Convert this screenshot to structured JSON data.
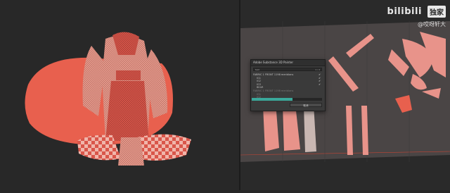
{
  "watermark": {
    "logo": "bilibili",
    "badge": "独家",
    "user": "@哎呀轩大"
  },
  "dialog": {
    "title": "Adobe Substance 3D Painter",
    "field_label": "test",
    "field_value": "1 / 2",
    "items": [
      {
        "label": "FABRIC 1 FRONT 1198 meridians",
        "indent": false,
        "dim": false,
        "checked": true
      },
      {
        "label": "IG1",
        "indent": true,
        "dim": false,
        "checked": true
      },
      {
        "label": "IG2",
        "indent": true,
        "dim": false,
        "checked": true
      },
      {
        "label": "IG3",
        "indent": true,
        "dim": false,
        "checked": true
      },
      {
        "label": "BEAR",
        "indent": true,
        "dim": false,
        "checked": false
      },
      {
        "label": "FABRIC 1 FRONT 1198 meridians",
        "indent": false,
        "dim": true,
        "checked": false
      },
      {
        "label": "IG1",
        "indent": true,
        "dim": true,
        "checked": false
      },
      {
        "label": "IG2",
        "indent": true,
        "dim": true,
        "checked": false
      }
    ],
    "progress_fraction": 0.58,
    "cancel_label": "取消"
  },
  "colors": {
    "mesh": "#e8604e",
    "mesh_light": "#f08a78",
    "progress": "#3aa89a",
    "uv_sheet": "#4a4545"
  }
}
